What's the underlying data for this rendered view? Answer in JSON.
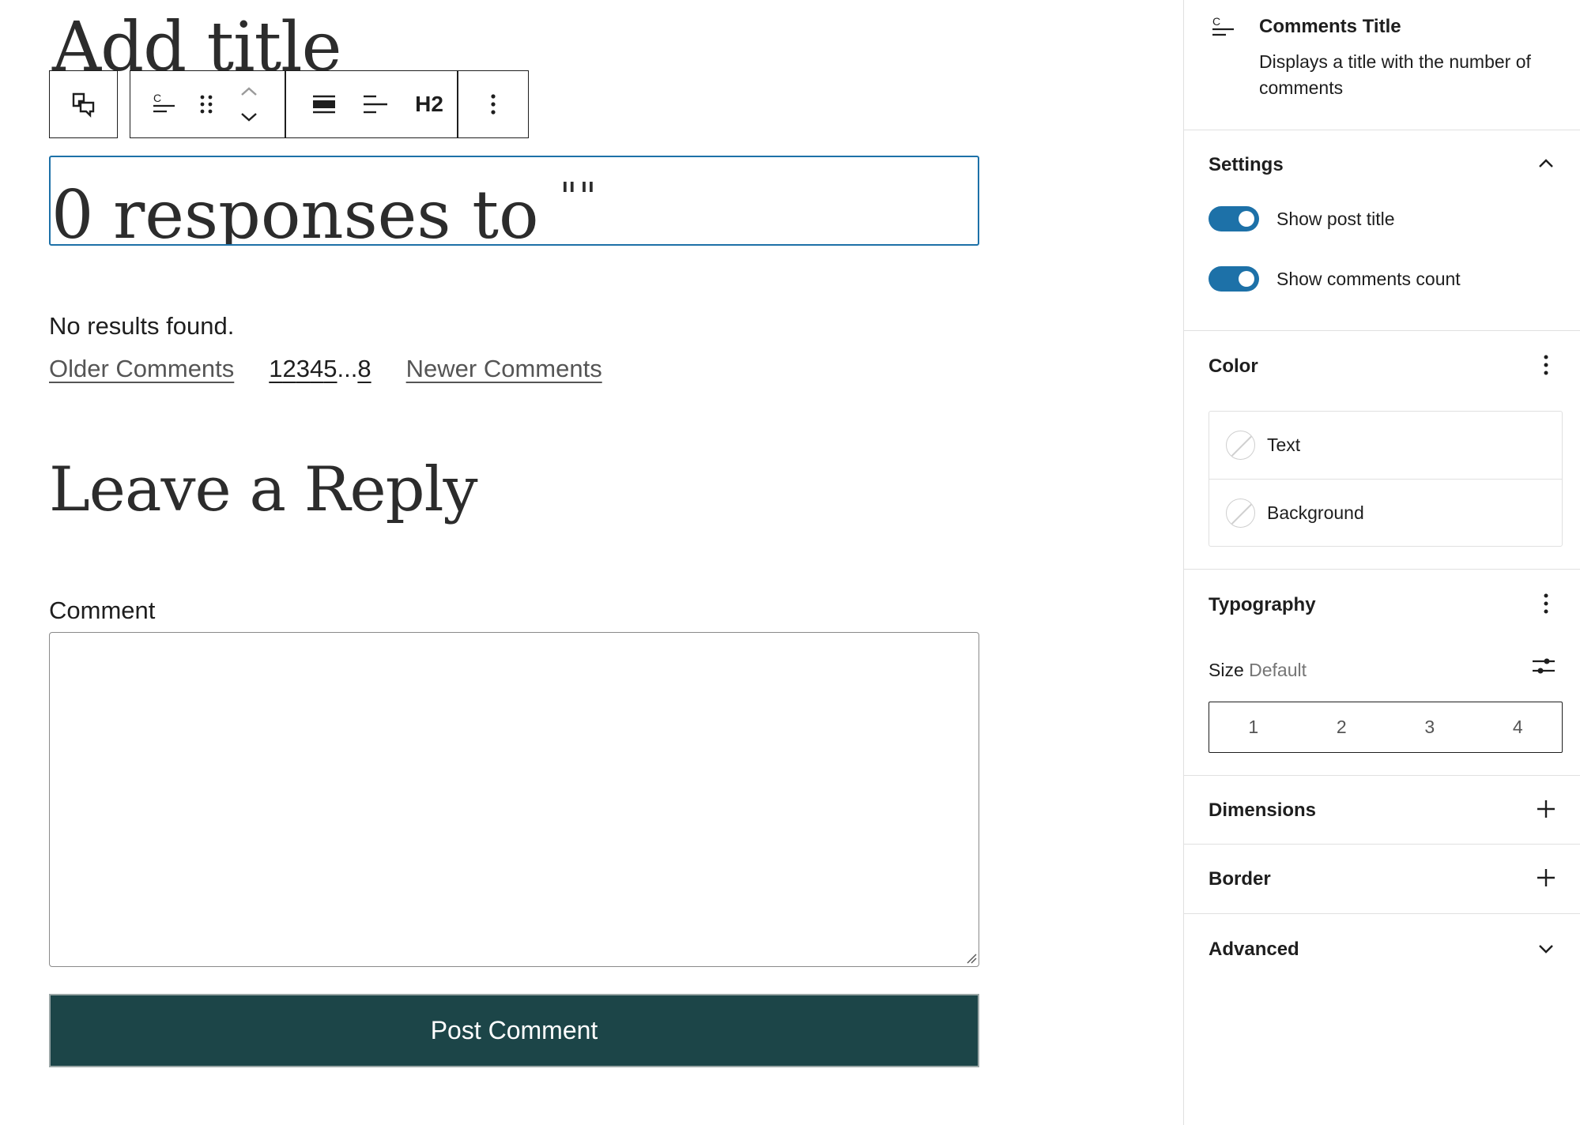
{
  "editor": {
    "post_title_placeholder": "Add title",
    "block_toolbar": {
      "heading_level": "H2"
    },
    "comments_title": {
      "count": "0",
      "text": "responses to",
      "quotes": "\"\""
    },
    "no_results": "No results found.",
    "pagination": {
      "older": "Older Comments",
      "pages": [
        "1",
        "2",
        "3",
        "4",
        "5"
      ],
      "ellipsis": "...",
      "last_page": "8",
      "newer": "Newer Comments"
    },
    "reply_heading": "Leave a Reply",
    "comment_label": "Comment",
    "comment_value": "",
    "submit_label": "Post Comment"
  },
  "sidebar": {
    "block_card": {
      "title": "Comments Title",
      "description": "Displays a title with the number of comments",
      "icon": "comments-title-icon"
    },
    "settings": {
      "title": "Settings",
      "toggles": [
        {
          "label": "Show post title",
          "checked": true
        },
        {
          "label": "Show comments count",
          "checked": true
        }
      ]
    },
    "color": {
      "title": "Color",
      "items": [
        {
          "label": "Text"
        },
        {
          "label": "Background"
        }
      ]
    },
    "typography": {
      "title": "Typography",
      "size_label": "Size",
      "size_value": "Default",
      "size_options": [
        "1",
        "2",
        "3",
        "4"
      ]
    },
    "dimensions": {
      "title": "Dimensions"
    },
    "border": {
      "title": "Border"
    },
    "advanced": {
      "title": "Advanced"
    }
  },
  "colors": {
    "accent": "#1d71a8",
    "submit_bg": "#1c4548"
  }
}
